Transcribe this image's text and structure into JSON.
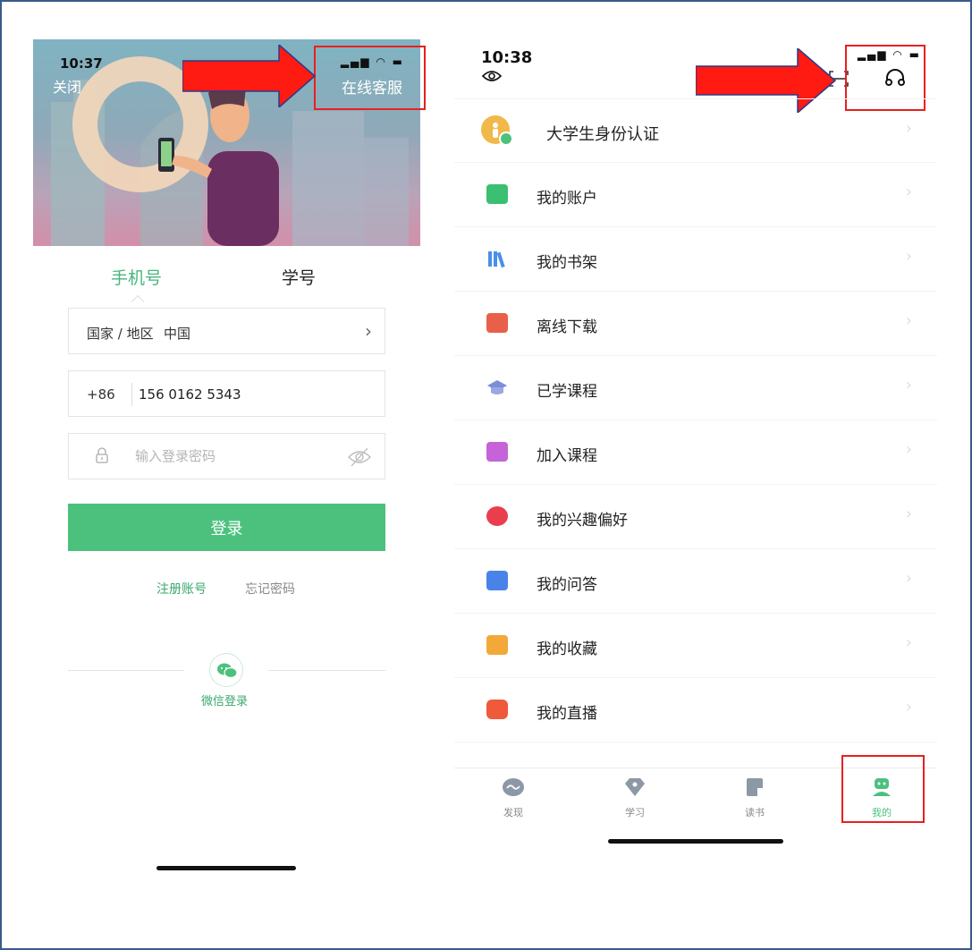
{
  "colors": {
    "accent": "#4cc17e",
    "highlight_box": "#e8201e",
    "arrow": "#ff1a12"
  },
  "left_screen": {
    "status_time": "10:37",
    "close_label": "关闭",
    "service_label": "在线客服",
    "tabs": {
      "phone": "手机号",
      "student_id": "学号"
    },
    "region": {
      "label": "国家 / 地区",
      "value": "中国"
    },
    "phone": {
      "country_code": "+86",
      "number": "156 0162 5343"
    },
    "password": {
      "placeholder": "输入登录密码"
    },
    "login_button": "登录",
    "register_link": "注册账号",
    "forgot_link": "忘记密码",
    "wechat_login": "微信登录"
  },
  "right_screen": {
    "status_time": "10:38",
    "menu": [
      {
        "label": "大学生身份认证",
        "icon": "student-verify-icon",
        "color": "#f1b84a"
      },
      {
        "label": "我的账户",
        "icon": "wallet-icon",
        "color": "#3bbf72"
      },
      {
        "label": "我的书架",
        "icon": "bookshelf-icon",
        "color": "#4a8fe8"
      },
      {
        "label": "离线下载",
        "icon": "download-icon",
        "color": "#e8604a"
      },
      {
        "label": "已学课程",
        "icon": "graduation-cap-icon",
        "color": "#7b8fd8"
      },
      {
        "label": "加入课程",
        "icon": "add-course-icon",
        "color": "#c563d8"
      },
      {
        "label": "我的兴趣偏好",
        "icon": "heart-icon",
        "color": "#ea3e4e"
      },
      {
        "label": "我的问答",
        "icon": "qa-icon",
        "color": "#4a83e8"
      },
      {
        "label": "我的收藏",
        "icon": "favorite-icon",
        "color": "#f2a93a"
      },
      {
        "label": "我的直播",
        "icon": "live-icon",
        "color": "#ef5a3a"
      }
    ],
    "tabbar": [
      {
        "label": "发现",
        "icon": "discover-icon"
      },
      {
        "label": "学习",
        "icon": "learn-icon"
      },
      {
        "label": "读书",
        "icon": "read-icon"
      },
      {
        "label": "我的",
        "icon": "profile-icon",
        "active": true
      }
    ]
  }
}
